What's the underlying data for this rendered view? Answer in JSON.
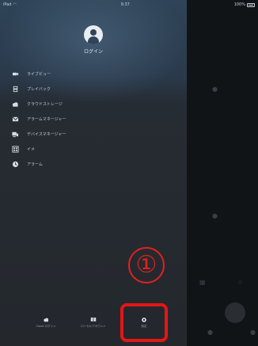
{
  "status_bar": {
    "carrier": "iPad",
    "time": "9:37",
    "battery": "100%"
  },
  "drawer": {
    "login_label": "ログイン",
    "items": [
      {
        "label": "ライブビュー",
        "icon": "camera-icon"
      },
      {
        "label": "プレイバック",
        "icon": "film-icon"
      },
      {
        "label": "クラウドストレージ",
        "icon": "cloud-icon"
      },
      {
        "label": "アラームマネージャー",
        "icon": "mail-icon"
      },
      {
        "label": "デバイスマネージャー",
        "icon": "devices-icon"
      },
      {
        "label": "イメ",
        "icon": "image-icon"
      },
      {
        "label": "アラーム",
        "icon": "alarm-icon"
      }
    ]
  },
  "footer": {
    "buttons": [
      {
        "label": "Cloud ログイン",
        "icon": "cloud-icon"
      },
      {
        "label": "ローカルアカウント",
        "icon": "book-icon"
      },
      {
        "label": "設定",
        "icon": "gear-icon"
      }
    ]
  },
  "annotation": {
    "step": "①",
    "color": "#e02020"
  }
}
